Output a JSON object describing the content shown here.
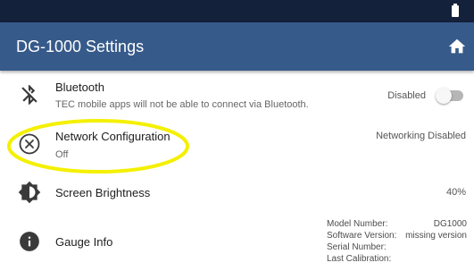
{
  "header": {
    "title": "DG-1000 Settings",
    "home_icon": "home-icon",
    "battery_icon": "battery-icon",
    "status_bar_color": "#14213a",
    "app_bar_color": "#365a8a"
  },
  "settings": {
    "bluetooth": {
      "icon": "bluetooth-disabled-icon",
      "title": "Bluetooth",
      "subtitle": "TEC mobile apps will not be able to connect via Bluetooth.",
      "value": "Disabled",
      "toggle_on": false
    },
    "network": {
      "icon": "close-circle-icon",
      "title": "Network Configuration",
      "subtitle": "Off",
      "value": "Networking Disabled"
    },
    "brightness": {
      "icon": "brightness-icon",
      "title": "Screen Brightness",
      "value": "40%"
    },
    "gauge_info": {
      "icon": "info-icon",
      "title": "Gauge Info",
      "model_label": "Model Number:",
      "model_value": "DG1000",
      "software_label": "Software Version:",
      "software_value": "missing version",
      "serial_label": "Serial Number:",
      "serial_value": "",
      "calibration_label": "Last Calibration:",
      "calibration_value": ""
    }
  },
  "annotation": {
    "highlight_color": "#f4f000"
  }
}
